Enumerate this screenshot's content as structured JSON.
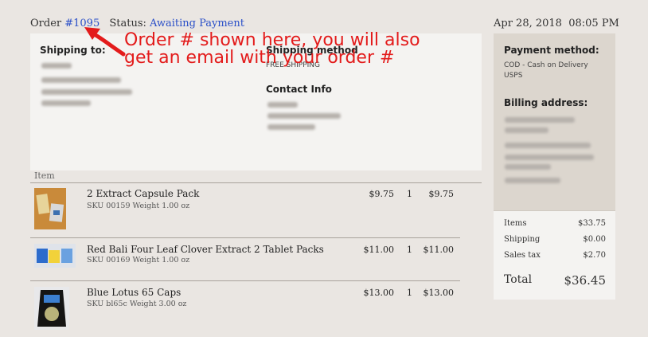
{
  "order": {
    "label": "Order",
    "number": "#1095",
    "status_label": "Status:",
    "status_value": "Awaiting Payment",
    "date": "Apr 28, 2018",
    "time": "08:05 PM"
  },
  "annotation": {
    "line1": "Order # shown here, you will also",
    "line2": "get an email with your order #",
    "color": "#e31b1b"
  },
  "shipping": {
    "to_label": "Shipping to:",
    "method_label": "Shipping method",
    "method_value": "FREE SHIPPING",
    "contact_label": "Contact Info"
  },
  "payment": {
    "method_label": "Payment method:",
    "method_line1": "COD - Cash on Delivery",
    "method_line2": "USPS",
    "billing_label": "Billing address:"
  },
  "items_header": "Item",
  "items": [
    {
      "name": "2 Extract Capsule Pack",
      "sku": "SKU 00159 Weight 1.00 oz",
      "price": "$9.75",
      "qty": "1",
      "total": "$9.75"
    },
    {
      "name": "Red Bali Four Leaf Clover Extract 2 Tablet Packs",
      "sku": "SKU 00169 Weight 1.00 oz",
      "price": "$11.00",
      "qty": "1",
      "total": "$11.00"
    },
    {
      "name": "Blue Lotus 65 Caps",
      "sku": "SKU bl65c Weight 3.00 oz",
      "price": "$13.00",
      "qty": "1",
      "total": "$13.00"
    }
  ],
  "totals": {
    "items_label": "Items",
    "items_value": "$33.75",
    "shipping_label": "Shipping",
    "shipping_value": "$0.00",
    "tax_label": "Sales tax",
    "tax_value": "$2.70",
    "total_label": "Total",
    "total_value": "$36.45"
  }
}
